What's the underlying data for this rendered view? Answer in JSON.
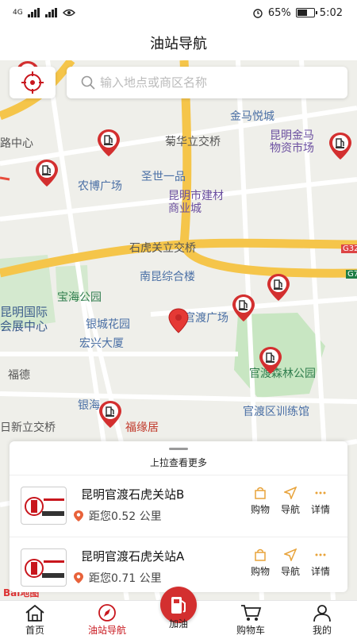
{
  "status_bar": {
    "network": "4G",
    "battery": "65%",
    "battery_level": 0.65,
    "time": "5:02"
  },
  "header": {
    "title": "油站导航"
  },
  "search": {
    "placeholder": "输入地点或商区名称"
  },
  "map": {
    "labels": {
      "jinma_yuecheng": "金马悦城",
      "kunming_jinma": "昆明金马",
      "wuzi_shichang": "物资市场",
      "lu_zhongxin": "路中心",
      "juhuali": "菊华立交桥",
      "nongbo": "农博广场",
      "shengshiyipin": "圣世一品",
      "jiancai1": "昆明市建材",
      "jiancai2": "商业城",
      "shihuguan": "石虎关立交桥",
      "g32": "G32",
      "g7": "G7",
      "baohai": "宝海公园",
      "nankun": "南昆综合楼",
      "guandu_guangchang": "官渡广场",
      "kunming_guoji": "昆明国际",
      "huizhan": "会展中心",
      "yincheng": "银城花园",
      "hongxing": "宏兴大厦",
      "guandu_senlin": "官渡森林公园",
      "fude": "福德",
      "yinhai": "银海",
      "guandu_xunlian": "官渡区训练馆",
      "fuyuanju": "福缘居",
      "rixin": "日新立交桥",
      "watermark": "Bai地图"
    }
  },
  "sheet": {
    "hint": "上拉查看更多",
    "stations": [
      {
        "name": "昆明官渡石虎关站B",
        "distance": "距您0.52 公里",
        "shop": "购物",
        "nav": "导航",
        "detail": "详情"
      },
      {
        "name": "昆明官渡石虎关站A",
        "distance": "距您0.71 公里",
        "shop": "购物",
        "nav": "导航",
        "detail": "详情"
      }
    ]
  },
  "nav": {
    "home": "首页",
    "station_nav": "油站导航",
    "refuel": "加油",
    "cart": "购物车",
    "mine": "我的"
  },
  "colors": {
    "accent": "#c8161d",
    "map_bg": "#efefea",
    "road_yellow": "#f5c54a"
  }
}
